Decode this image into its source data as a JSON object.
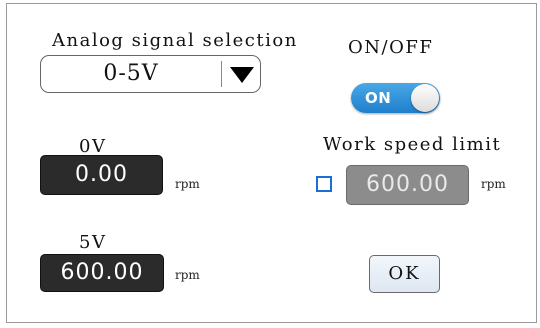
{
  "analog": {
    "label": "Analog signal selection",
    "selected": "0-5V"
  },
  "power": {
    "label": "ON/OFF",
    "toggle_text": "ON",
    "state": "on"
  },
  "zero_volt": {
    "label": "0V",
    "value": "0.00",
    "unit": "rpm"
  },
  "five_volt": {
    "label": "5V",
    "value": "600.00",
    "unit": "rpm"
  },
  "speed_limit": {
    "label": "Work speed limit",
    "value": "600.00",
    "unit": "rpm",
    "checked": false
  },
  "ok_button": {
    "label": "OK"
  },
  "colors": {
    "toggle_on": "#1f7fcc",
    "checkbox_border": "#1a6fd0",
    "field_dark": "#2b2b2b",
    "field_disabled": "#8c8c8c"
  },
  "icons": {
    "dropdown": "triangle-down-icon"
  }
}
